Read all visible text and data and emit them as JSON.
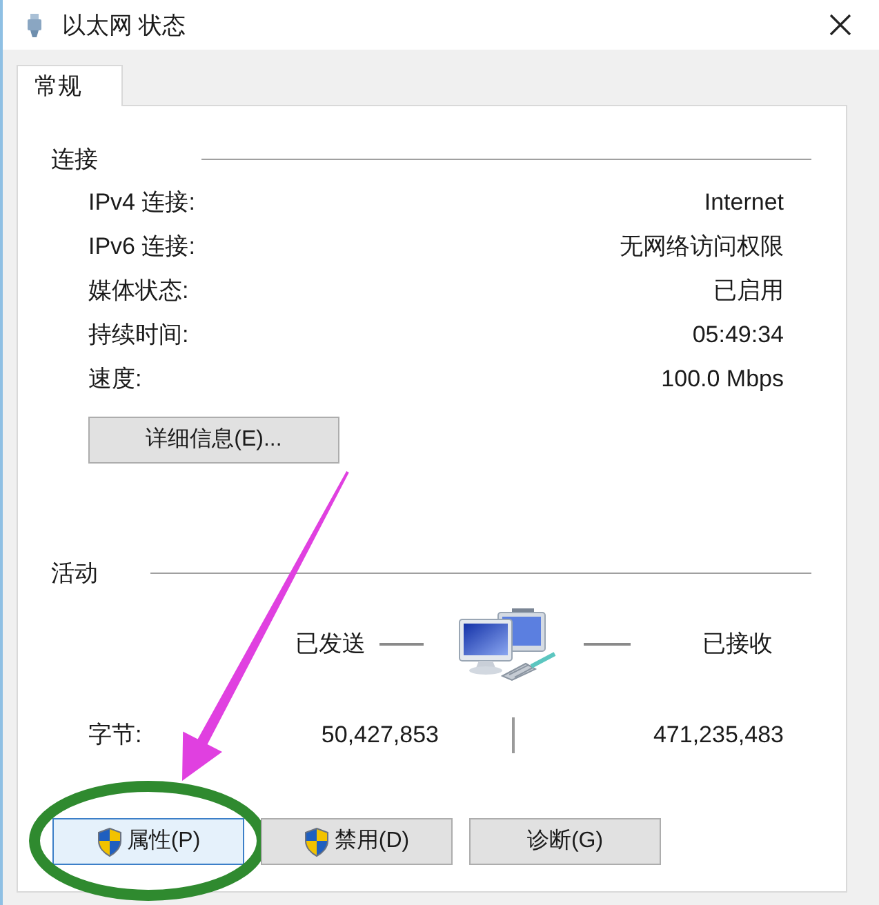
{
  "window": {
    "title": "以太网 状态"
  },
  "tabs": [
    {
      "label": "常规",
      "selected": true
    }
  ],
  "connection": {
    "heading": "连接",
    "rows": [
      {
        "label": "IPv4 连接:",
        "value": "Internet"
      },
      {
        "label": "IPv6 连接:",
        "value": "无网络访问权限"
      },
      {
        "label": "媒体状态:",
        "value": "已启用"
      },
      {
        "label": "持续时间:",
        "value": "05:49:34"
      },
      {
        "label": "速度:",
        "value": "100.0 Mbps"
      }
    ],
    "details_button": "详细信息(E)..."
  },
  "activity": {
    "heading": "活动",
    "sent_label": "已发送",
    "received_label": "已接收",
    "bytes": {
      "label": "字节:",
      "sent": "50,427,853",
      "received": "471,235,483"
    }
  },
  "buttons": [
    {
      "label": "属性(P)",
      "shield": true,
      "focused": true,
      "circled": true
    },
    {
      "label": "禁用(D)",
      "shield": true,
      "focused": false,
      "circled": false
    },
    {
      "label": "诊断(G)",
      "shield": false,
      "focused": false,
      "circled": false
    }
  ]
}
